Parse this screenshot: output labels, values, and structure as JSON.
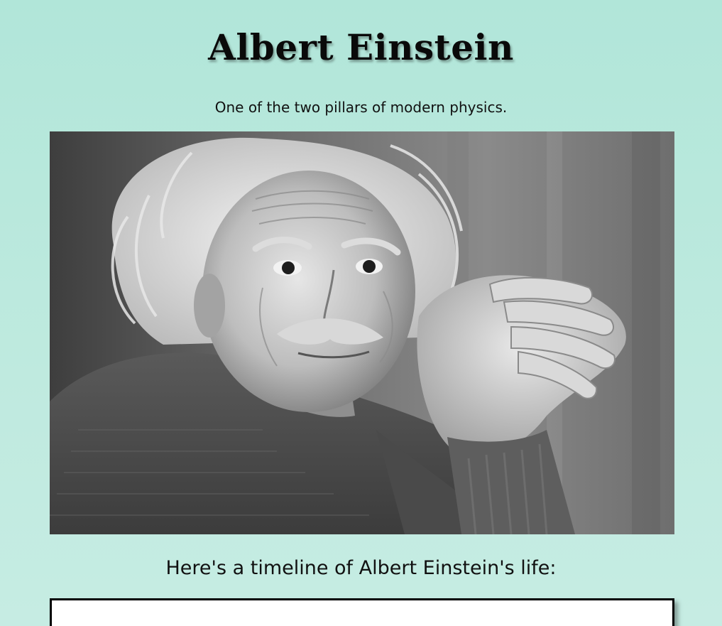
{
  "header": {
    "title": "Albert Einstein",
    "tagline": "One of the two pillars of modern physics."
  },
  "photo": {
    "alt": "Albert Einstein",
    "tone": "black-and-white portrait"
  },
  "timeline": {
    "heading": "Here's a timeline of Albert Einstein's life:"
  },
  "colors": {
    "background": "#b1e6d9",
    "text": "#111111",
    "timeline_border": "#000000",
    "timeline_fill": "#ffffff"
  }
}
